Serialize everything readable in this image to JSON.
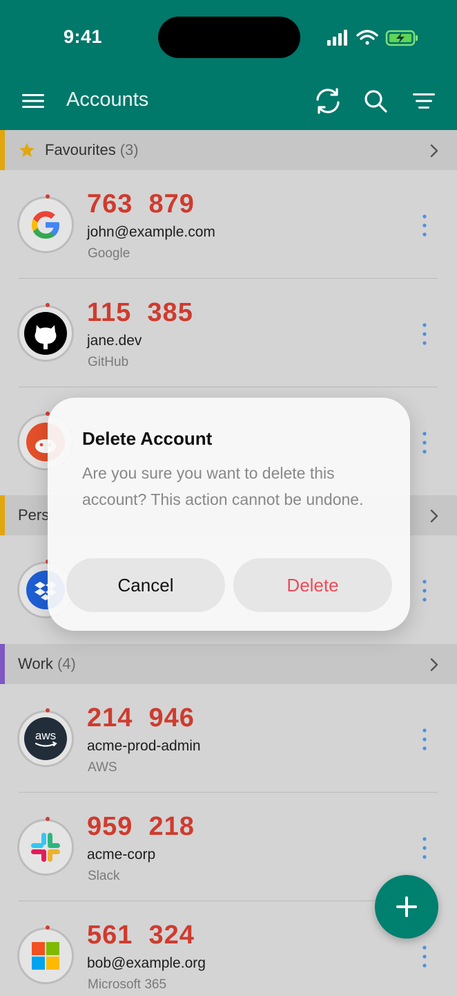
{
  "status": {
    "time": "9:41"
  },
  "appbar": {
    "title": "Accounts"
  },
  "sections": [
    {
      "label": "Favourites",
      "count": "(3)",
      "color": "#e2a60e"
    },
    {
      "label": "Pers",
      "count": "",
      "color": "#e2a60e"
    },
    {
      "label": "Work",
      "count": "(4)",
      "color": "#7e57c2"
    }
  ],
  "accounts": [
    {
      "code": "763  879",
      "account": "john@example.com",
      "issuer": "Google",
      "icon": "google-icon"
    },
    {
      "code": "115  385",
      "account": "jane.dev",
      "issuer": "GitHub",
      "icon": "github-icon"
    },
    {
      "code": "",
      "account": "",
      "issuer": "",
      "icon": "reddit-icon"
    },
    {
      "code": "",
      "account": "",
      "issuer": "",
      "icon": "dropbox-icon"
    },
    {
      "code": "214  946",
      "account": "acme-prod-admin",
      "issuer": "AWS",
      "icon": "aws-icon"
    },
    {
      "code": "959  218",
      "account": "acme-corp",
      "issuer": "Slack",
      "icon": "slack-icon"
    },
    {
      "code": "561  324",
      "account": "bob@example.org",
      "issuer": "Microsoft 365",
      "icon": "microsoft-icon"
    }
  ],
  "dialog": {
    "title": "Delete Account",
    "message": "Are you sure you want to delete this account? This action cannot be undone.",
    "cancel_label": "Cancel",
    "delete_label": "Delete"
  },
  "colors": {
    "appbar": "#00786a",
    "code": "#cf3b2e",
    "delete": "#ee4a57",
    "favourites_accent": "#e2a60e",
    "work_accent": "#7e57c2"
  }
}
